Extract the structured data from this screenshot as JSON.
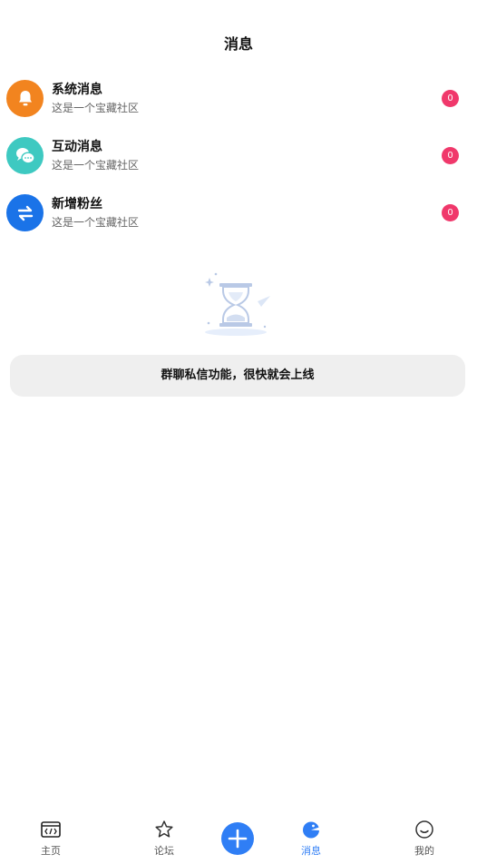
{
  "header": {
    "title": "消息"
  },
  "messages": [
    {
      "title": "系统消息",
      "subtitle": "这是一个宝藏社区",
      "badge": "0",
      "icon": "bell-icon",
      "color": "#f2841f"
    },
    {
      "title": "互动消息",
      "subtitle": "这是一个宝藏社区",
      "badge": "0",
      "icon": "chat-icon",
      "color": "#3ec9c1"
    },
    {
      "title": "新增粉丝",
      "subtitle": "这是一个宝藏社区",
      "badge": "0",
      "icon": "swap-arrows-icon",
      "color": "#1a73e8"
    }
  ],
  "notice": {
    "text": "群聊私信功能，很快就会上线"
  },
  "tabbar": {
    "items": [
      {
        "label": "主页",
        "icon": "code-window-icon"
      },
      {
        "label": "论坛",
        "icon": "star-icon"
      },
      {
        "label": "消息",
        "icon": "message-bird-icon",
        "active": true
      },
      {
        "label": "我的",
        "icon": "smiley-icon"
      }
    ],
    "add_icon": "plus-icon"
  },
  "colors": {
    "accent": "#2f7ef5",
    "badge": "#f0386b",
    "notice_bg": "#efefef"
  }
}
